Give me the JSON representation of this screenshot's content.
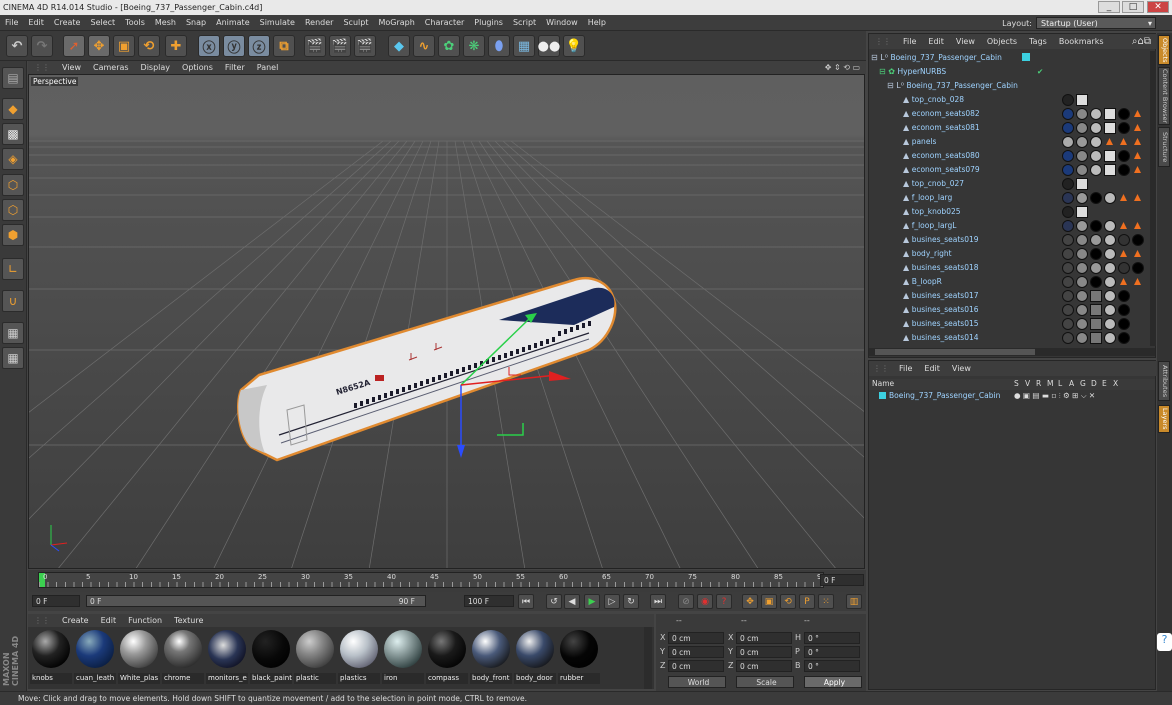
{
  "window": {
    "title": "CINEMA 4D R14.014 Studio - [Boeing_737_Passenger_Cabin.c4d]",
    "controls": [
      "_",
      "□",
      "✕"
    ]
  },
  "menubar": [
    "File",
    "Edit",
    "Create",
    "Select",
    "Tools",
    "Mesh",
    "Snap",
    "Animate",
    "Simulate",
    "Render",
    "Sculpt",
    "MoGraph",
    "Character",
    "Plugins",
    "Script",
    "Window",
    "Help"
  ],
  "layout": {
    "label": "Layout:",
    "value": "Startup (User)"
  },
  "viewport": {
    "menu": [
      "View",
      "Cameras",
      "Display",
      "Options",
      "Filter",
      "Panel"
    ],
    "label": "Perspective",
    "registration": "N8652A"
  },
  "timeline": {
    "ticks": [
      "0",
      "5",
      "10",
      "15",
      "20",
      "25",
      "30",
      "35",
      "40",
      "45",
      "50",
      "55",
      "60",
      "65",
      "70",
      "75",
      "80",
      "85",
      "90"
    ],
    "frame": "0 F"
  },
  "transport": {
    "start": "0 F",
    "current": "0 F",
    "end": "90 F",
    "max": "100 F"
  },
  "objmanager": {
    "menu": [
      "File",
      "Edit",
      "View",
      "Objects",
      "Tags",
      "Bookmarks"
    ],
    "objects": [
      {
        "name": "Boeing_737_Passenger_Cabin",
        "level": 0
      },
      {
        "name": "HyperNURBS",
        "level": 1
      },
      {
        "name": "Boeing_737_Passenger_Cabin",
        "level": 2
      },
      {
        "name": "top_cnob_028",
        "level": 3
      },
      {
        "name": "econom_seats082",
        "level": 3
      },
      {
        "name": "econom_seats081",
        "level": 3
      },
      {
        "name": "panels",
        "level": 3
      },
      {
        "name": "econom_seats080",
        "level": 3
      },
      {
        "name": "econom_seats079",
        "level": 3
      },
      {
        "name": "top_cnob_027",
        "level": 3
      },
      {
        "name": "f_loop_larg",
        "level": 3
      },
      {
        "name": "top_knob025",
        "level": 3
      },
      {
        "name": "f_loop_largL",
        "level": 3
      },
      {
        "name": "busines_seats019",
        "level": 3
      },
      {
        "name": "body_right",
        "level": 3
      },
      {
        "name": "busines_seats018",
        "level": 3
      },
      {
        "name": "B_loopR",
        "level": 3
      },
      {
        "name": "busines_seats017",
        "level": 3
      },
      {
        "name": "busines_seats016",
        "level": 3
      },
      {
        "name": "busines_seats015",
        "level": 3
      },
      {
        "name": "busines_seats014",
        "level": 3
      }
    ]
  },
  "layermanager": {
    "menu": [
      "File",
      "Edit",
      "View"
    ],
    "header": {
      "name": "Name",
      "cols": [
        "S",
        "V",
        "R",
        "M",
        "L",
        "A",
        "G",
        "D",
        "E",
        "X"
      ]
    },
    "layer": "Boeing_737_Passenger_Cabin"
  },
  "materialmanager": {
    "menu": [
      "Create",
      "Edit",
      "Function",
      "Texture"
    ],
    "materials": [
      {
        "name": "knobs",
        "color": "#222"
      },
      {
        "name": "cuan_leath",
        "color": "#1b3a7a"
      },
      {
        "name": "White_plas",
        "color": "#9a9a9a"
      },
      {
        "name": "chrome",
        "color": "#777"
      },
      {
        "name": "monitors_e",
        "color": "#2a3555"
      },
      {
        "name": "black_paint",
        "color": "#080808"
      },
      {
        "name": "plastic",
        "color": "#888"
      },
      {
        "name": "plastics",
        "color": "#b8c0c8"
      },
      {
        "name": "iron",
        "color": "#8fa0a0"
      },
      {
        "name": "compass",
        "color": "#1a1a1a"
      },
      {
        "name": "body_front",
        "color": "#4a5a7a"
      },
      {
        "name": "body_door",
        "color": "#3a4a6a"
      },
      {
        "name": "rubber",
        "color": "#050505"
      }
    ]
  },
  "coords": {
    "header": [
      "--",
      "--",
      "--"
    ],
    "rows": [
      [
        "X",
        "0 cm",
        "X",
        "0 cm",
        "H",
        "0 °"
      ],
      [
        "Y",
        "0 cm",
        "Y",
        "0 cm",
        "P",
        "0 °"
      ],
      [
        "Z",
        "0 cm",
        "Z",
        "0 cm",
        "B",
        "0 °"
      ]
    ],
    "world": "World",
    "scale": "Scale",
    "apply": "Apply"
  },
  "righttabs": [
    "Objects",
    "Content Browser",
    "Structure",
    "Attributes",
    "Layers"
  ],
  "status": "Move: Click and drag to move elements. Hold down SHIFT to quantize movement / add to the selection in point mode, CTRL to remove.",
  "branding": "MAXON CINEMA 4D"
}
